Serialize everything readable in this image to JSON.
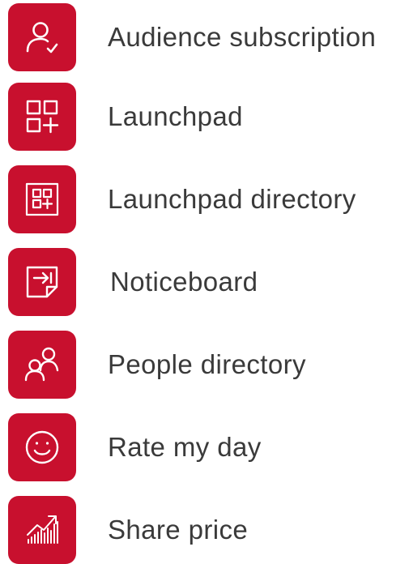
{
  "colors": {
    "tile_background": "#c8102e",
    "icon_stroke": "#ffffff",
    "label_text": "#3a3a3a"
  },
  "items": [
    {
      "label": "Audience subscription",
      "icon": "user-check-icon"
    },
    {
      "label": "Launchpad",
      "icon": "grid-plus-icon"
    },
    {
      "label": "Launchpad directory",
      "icon": "framed-grid-plus-icon"
    },
    {
      "label": "Noticeboard",
      "icon": "noticeboard-icon"
    },
    {
      "label": "People directory",
      "icon": "people-icon"
    },
    {
      "label": "Rate my day",
      "icon": "smiley-icon"
    },
    {
      "label": "Share price",
      "icon": "rising-chart-icon"
    }
  ]
}
